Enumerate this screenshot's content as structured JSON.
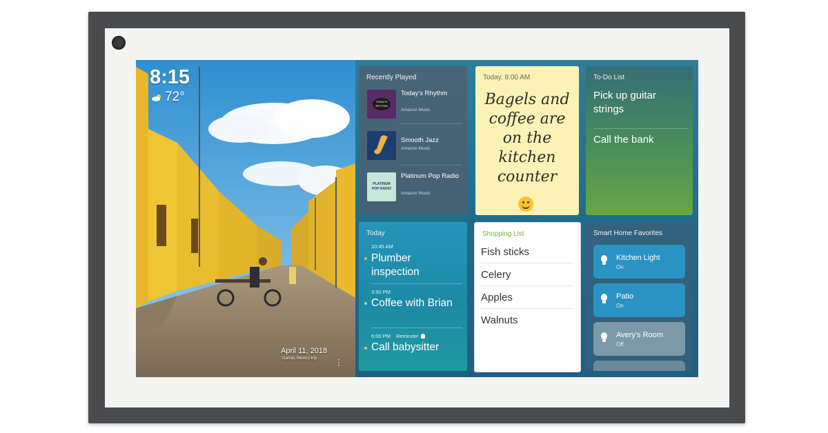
{
  "clock": {
    "time": "8:15",
    "temperature": "72°",
    "weather_icon": "cloud-sun-icon"
  },
  "photo": {
    "date": "April 11, 2018",
    "location": "Izamal, Mexico trip"
  },
  "recently_played": {
    "title": "Recently Played",
    "tracks": [
      {
        "name": "Today's Rhythm",
        "source": "Amazon Music",
        "art_label": "TODAY'S RHYTHM",
        "art_color": "#5a2a66"
      },
      {
        "name": "Smooth Jazz",
        "source": "Amazon Music",
        "art_color": "#1d3d70"
      },
      {
        "name": "Platinum Pop Radio",
        "source": "Amazon Music",
        "art_label": "PLATINUM POP RADIO",
        "art_color": "#c7e6d8"
      }
    ]
  },
  "note": {
    "title": "Today, 8:00 AM",
    "text": "Bagels and coffee are on the kitchen counter",
    "emoji": "smile-icon"
  },
  "todo": {
    "title": "To-Do List",
    "items": [
      "Pick up guitar strings",
      "Call the bank"
    ]
  },
  "today": {
    "title": "Today",
    "events": [
      {
        "time": "10:45 AM",
        "title": "Plumber inspection",
        "dot_color": "#f2a65a"
      },
      {
        "time": "3:50 PM",
        "title": "Coffee with Brian",
        "dot_color": "#8fe3c2"
      },
      {
        "time": "6:00 PM",
        "reminder": "Reminder",
        "title": "Call babysitter",
        "dot_color": "#f2c14e"
      }
    ]
  },
  "shopping": {
    "title": "Shopping List",
    "items": [
      "Fish sticks",
      "Celery",
      "Apples",
      "Walnuts"
    ]
  },
  "smart_home": {
    "title": "Smart Home Favorites",
    "devices": [
      {
        "name": "Kitchen Light",
        "state": "On",
        "color": "#2a93c4"
      },
      {
        "name": "Patio",
        "state": "On",
        "color": "#2a93c4"
      },
      {
        "name": "Avery's Room",
        "state": "Off",
        "color": "#8aa3b3"
      }
    ]
  }
}
